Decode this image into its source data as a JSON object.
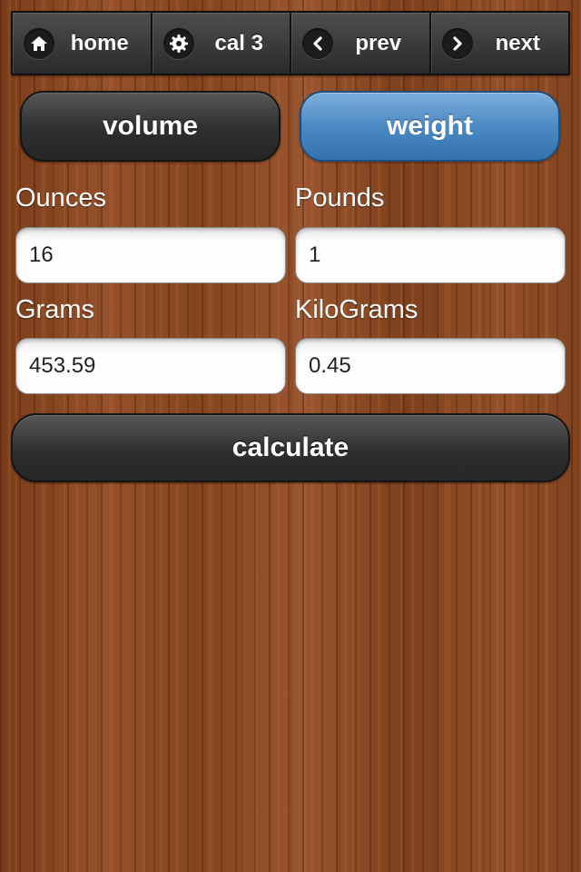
{
  "colors": {
    "accent": "#4a89c4",
    "bar_dark": "#2a2a2a",
    "wood": "#8a4a22"
  },
  "nav": {
    "items": [
      {
        "label": "home",
        "icon": "home-icon"
      },
      {
        "label": "cal 3",
        "icon": "gear-icon"
      },
      {
        "label": "prev",
        "icon": "chevron-left-icon"
      },
      {
        "label": "next",
        "icon": "chevron-right-icon"
      }
    ]
  },
  "segments": {
    "volume_label": "volume",
    "weight_label": "weight",
    "selected": "weight"
  },
  "fields": {
    "ounces": {
      "label": "Ounces",
      "value": "16"
    },
    "pounds": {
      "label": "Pounds",
      "value": "1"
    },
    "grams": {
      "label": "Grams",
      "value": "453.59"
    },
    "kilograms": {
      "label": "KiloGrams",
      "value": "0.45"
    }
  },
  "actions": {
    "calculate_label": "calculate"
  }
}
